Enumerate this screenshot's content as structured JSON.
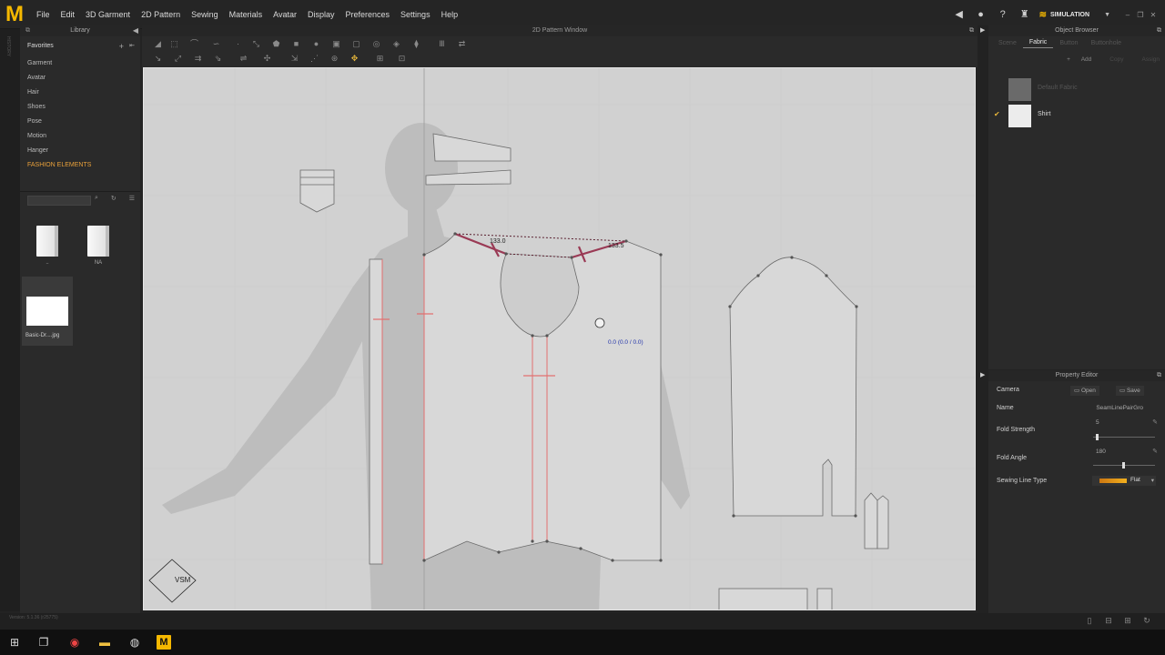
{
  "menubar": {
    "logo": "M",
    "items": [
      "File",
      "Edit",
      "3D Garment",
      "2D Pattern",
      "Sewing",
      "Materials",
      "Avatar",
      "Display",
      "Preferences",
      "Settings",
      "Help"
    ],
    "mode_label": "SIMULATION"
  },
  "library": {
    "title": "Library",
    "favorites_label": "Favorites",
    "items": [
      "Garment",
      "Avatar",
      "Hair",
      "Shoes",
      "Pose",
      "Motion",
      "Hanger",
      "FASHION ELEMENTS"
    ],
    "files": [
      {
        "name": ".."
      },
      {
        "name": "NA"
      },
      {
        "name": "Basic-Dr....jpg"
      }
    ]
  },
  "pattern_window": {
    "title": "2D Pattern Window",
    "measure_left": "133.0",
    "measure_right": "133.5",
    "coord_readout": "0.0 (0.0 / 0.0)",
    "vsm_label": "VSM"
  },
  "object_browser": {
    "title": "Object Browser",
    "tabs": [
      "Scene",
      "Fabric",
      "Button",
      "Buttonhole"
    ],
    "active_tab": "Fabric",
    "actions": {
      "add": "Add",
      "copy": "Copy",
      "assign": "Assign"
    },
    "fabrics": [
      {
        "name": "Default Fabric",
        "checked": false
      },
      {
        "name": "Shirt",
        "checked": true
      }
    ]
  },
  "property_editor": {
    "title": "Property Editor",
    "camera_label": "Camera",
    "open_label": "Open",
    "save_label": "Save",
    "name_label": "Name",
    "name_value": "SeamLinePairGro",
    "fold_strength_label": "Fold Strength",
    "fold_strength_value": "5",
    "fold_angle_label": "Fold Angle",
    "fold_angle_value": "180",
    "sewing_line_type_label": "Sewing Line Type",
    "sewing_line_type_value": "Flat"
  },
  "status": {
    "version": "Version: 5.1.36 (r25775)"
  },
  "colors": {
    "accent": "#f5b800",
    "seam_highlight": "#9a3a55",
    "seam_line": "#e27070",
    "canvas_bg": "#d1d1d1"
  }
}
